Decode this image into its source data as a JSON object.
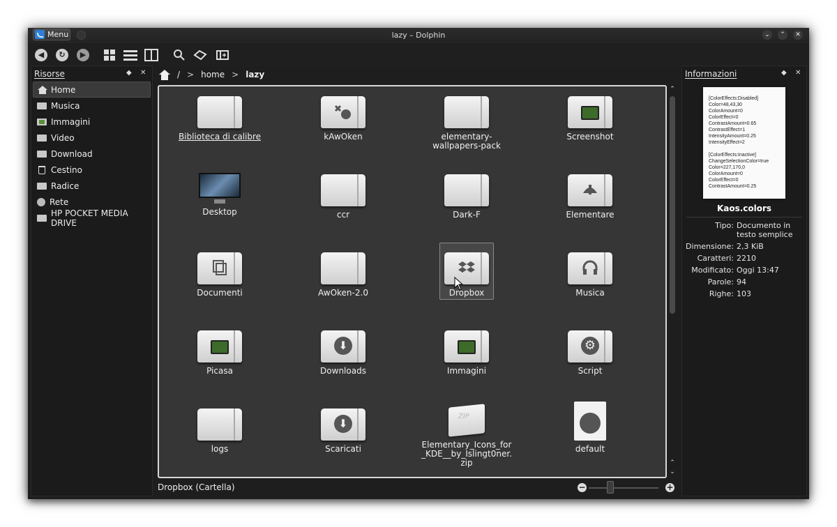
{
  "window": {
    "title": "lazy – Dolphin"
  },
  "titlebar": {
    "menu_label": "Menu",
    "minimize": "⌄",
    "maximize": "⌃",
    "close": "✕"
  },
  "toolbar": {
    "back": "back-icon",
    "reload": "reload-icon",
    "forward": "forward-icon",
    "icons_view": "icons-view",
    "details_view": "details-view",
    "split": "split-view",
    "search": "search-icon",
    "tag": "tag-icon",
    "preview": "preview-icon"
  },
  "places": {
    "title": "Risorse",
    "items": [
      {
        "label": "Home",
        "icon": "home-icon"
      },
      {
        "label": "Musica",
        "icon": "folder-icon"
      },
      {
        "label": "Immagini",
        "icon": "image-folder-icon"
      },
      {
        "label": "Video",
        "icon": "video-folder-icon"
      },
      {
        "label": "Download",
        "icon": "download-folder-icon"
      },
      {
        "label": "Cestino",
        "icon": "trash-icon"
      },
      {
        "label": "Radice",
        "icon": "drive-icon"
      },
      {
        "label": "Rete",
        "icon": "network-icon"
      },
      {
        "label": "HP POCKET MEDIA DRIVE",
        "icon": "usb-drive-icon"
      }
    ]
  },
  "breadcrumb": {
    "root": "/",
    "home": "home",
    "current": "lazy"
  },
  "files": [
    {
      "label": "Biblioteca di calibre",
      "type": "folder"
    },
    {
      "label": "kAwOken",
      "type": "folder"
    },
    {
      "label": "elementary-wallpapers-pack",
      "type": "folder"
    },
    {
      "label": "Screenshot",
      "type": "folder-image"
    },
    {
      "label": "Desktop",
      "type": "monitor"
    },
    {
      "label": "ccr",
      "type": "folder"
    },
    {
      "label": "Dark-F",
      "type": "folder"
    },
    {
      "label": "Elementare",
      "type": "folder"
    },
    {
      "label": "Documenti",
      "type": "folder"
    },
    {
      "label": "AwOken-2.0",
      "type": "folder"
    },
    {
      "label": "Dropbox",
      "type": "folder"
    },
    {
      "label": "Musica",
      "type": "folder"
    },
    {
      "label": "Picasa",
      "type": "folder-image"
    },
    {
      "label": "Downloads",
      "type": "folder-download"
    },
    {
      "label": "Immagini",
      "type": "folder-image"
    },
    {
      "label": "Script",
      "type": "folder-gear"
    },
    {
      "label": "logs",
      "type": "folder"
    },
    {
      "label": "Scaricati",
      "type": "folder-download"
    },
    {
      "label": "Elementary_Icons_for_KDE__by_Islingt0ner.zip",
      "type": "zip"
    },
    {
      "label": "default",
      "type": "document"
    }
  ],
  "status": {
    "text": "Dropbox (Cartella)"
  },
  "info": {
    "title": "Informazioni",
    "preview_text": "[ColorEffects:Disabled]\nColor=48,43,30\nColorAmount=0\nColorEffect=0\nContrastAmount=0.65\nContrastEffect=1\nIntensityAmount=0.25\nIntensityEffect=2\n\n[ColorEffects:Inactive]\nChangeSelectionColor=true\nColor=227,170,0\nColorAmount=0\nColorEffect=0\nContrastAmount=0.25",
    "file_name": "Kaos.colors",
    "rows": [
      {
        "key": "Tipo:",
        "value": "Documento in testo semplice"
      },
      {
        "key": "Dimensione:",
        "value": "2,3 KiB"
      },
      {
        "key": "Caratteri:",
        "value": "2210"
      },
      {
        "key": "Modificato:",
        "value": "Oggi 13:47"
      },
      {
        "key": "Parole:",
        "value": "94"
      },
      {
        "key": "Righe:",
        "value": "103"
      }
    ]
  }
}
